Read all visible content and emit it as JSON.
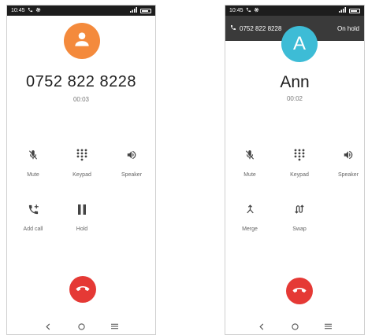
{
  "phone1": {
    "status": {
      "time": "10:45"
    },
    "call": {
      "name": "0752 822 8228",
      "timer": "00:03"
    },
    "controls": {
      "mute": "Mute",
      "keypad": "Keypad",
      "speaker": "Speaker",
      "add_call": "Add call",
      "hold": "Hold"
    }
  },
  "phone2": {
    "status": {
      "time": "10:45"
    },
    "held": {
      "number": "0752 822 8228",
      "state": "On hold"
    },
    "avatar_letter": "A",
    "call": {
      "name": "Ann",
      "timer": "00:02"
    },
    "controls": {
      "mute": "Mute",
      "keypad": "Keypad",
      "speaker": "Speaker",
      "merge": "Merge",
      "swap": "Swap"
    }
  },
  "icons": [
    "phone-icon",
    "gear-icon",
    "signal-icon",
    "battery-icon",
    "person-icon",
    "mute-icon",
    "keypad-icon",
    "speaker-icon",
    "add-call-icon",
    "hold-icon",
    "merge-icon",
    "swap-icon",
    "end-call-icon",
    "back-icon",
    "home-icon",
    "recents-icon"
  ],
  "colors": {
    "avatar1": "#f48a3c",
    "avatar2": "#3dbcd6",
    "end_call": "#e53935",
    "held_bar": "#3a3a3a"
  }
}
